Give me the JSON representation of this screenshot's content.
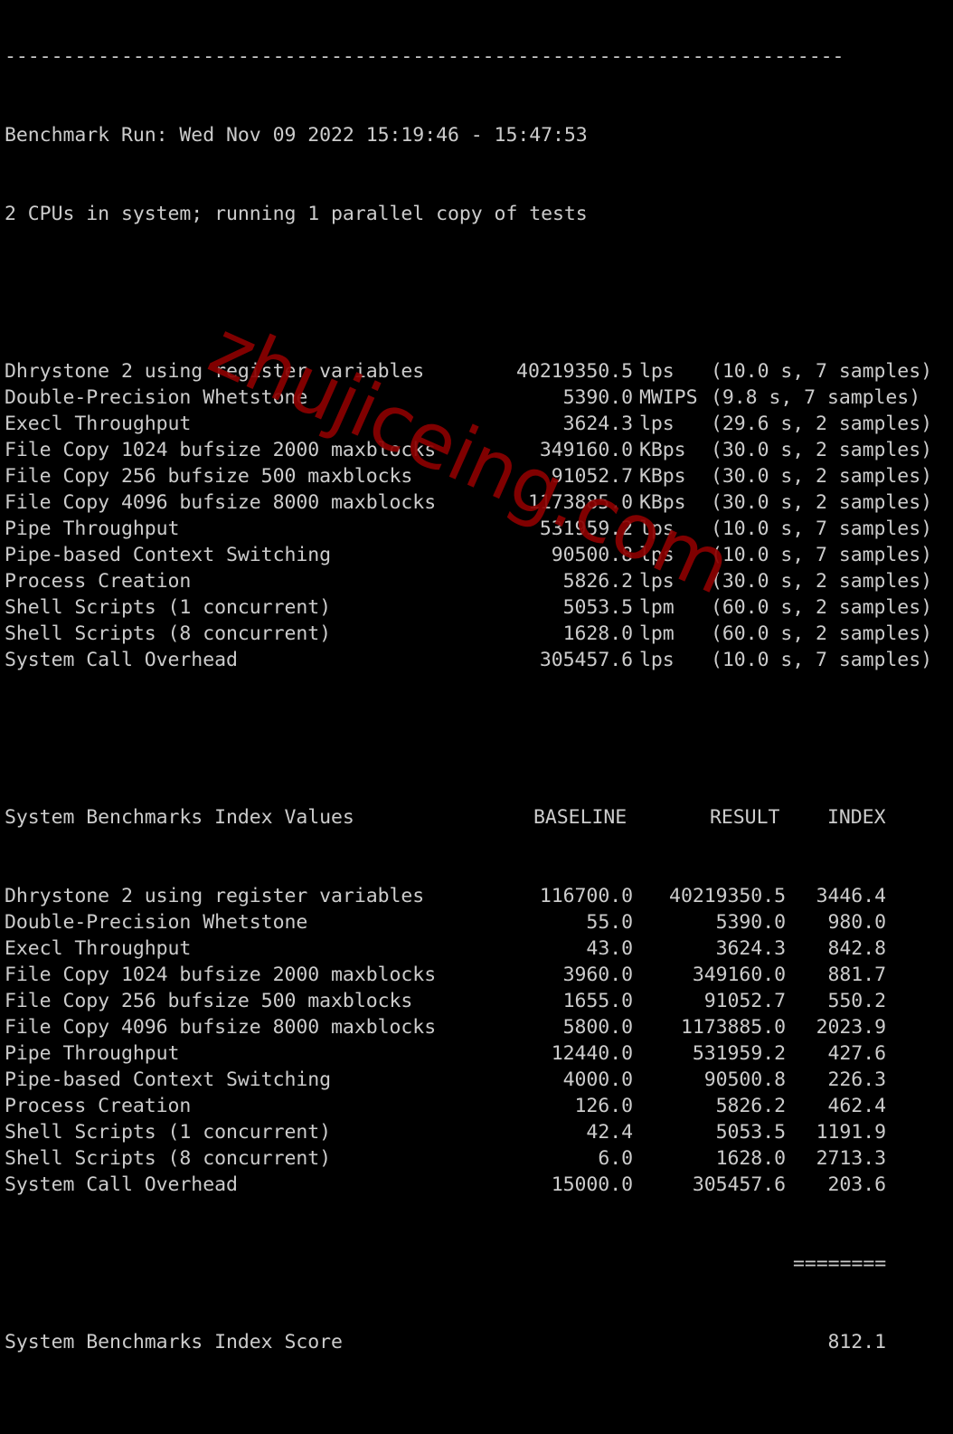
{
  "separator": "------------------------------------------------------------------------",
  "header": {
    "run_line": "Benchmark Run: Wed Nov 09 2022 15:19:46 - 15:47:53",
    "cpu_line": "2 CPUs in system; running 1 parallel copy of tests"
  },
  "results": [
    {
      "name": "Dhrystone 2 using register variables",
      "value": "40219350.5",
      "unit": "lps",
      "detail": "(10.0 s, 7 samples)"
    },
    {
      "name": "Double-Precision Whetstone",
      "value": "5390.0",
      "unit": "MWIPS",
      "detail": "(9.8 s, 7 samples)"
    },
    {
      "name": "Execl Throughput",
      "value": "3624.3",
      "unit": "lps",
      "detail": "(29.6 s, 2 samples)"
    },
    {
      "name": "File Copy 1024 bufsize 2000 maxblocks",
      "value": "349160.0",
      "unit": "KBps",
      "detail": "(30.0 s, 2 samples)"
    },
    {
      "name": "File Copy 256 bufsize 500 maxblocks",
      "value": "91052.7",
      "unit": "KBps",
      "detail": "(30.0 s, 2 samples)"
    },
    {
      "name": "File Copy 4096 bufsize 8000 maxblocks",
      "value": "1173885.0",
      "unit": "KBps",
      "detail": "(30.0 s, 2 samples)"
    },
    {
      "name": "Pipe Throughput",
      "value": "531959.2",
      "unit": "lps",
      "detail": "(10.0 s, 7 samples)"
    },
    {
      "name": "Pipe-based Context Switching",
      "value": "90500.8",
      "unit": "lps",
      "detail": "(10.0 s, 7 samples)"
    },
    {
      "name": "Process Creation",
      "value": "5826.2",
      "unit": "lps",
      "detail": "(30.0 s, 2 samples)"
    },
    {
      "name": "Shell Scripts (1 concurrent)",
      "value": "5053.5",
      "unit": "lpm",
      "detail": "(60.0 s, 2 samples)"
    },
    {
      "name": "Shell Scripts (8 concurrent)",
      "value": "1628.0",
      "unit": "lpm",
      "detail": "(60.0 s, 2 samples)"
    },
    {
      "name": "System Call Overhead",
      "value": "305457.6",
      "unit": "lps",
      "detail": "(10.0 s, 7 samples)"
    }
  ],
  "index_table": {
    "title": "System Benchmarks Index Values",
    "headers": {
      "baseline": "BASELINE",
      "result": "RESULT",
      "index": "INDEX"
    },
    "rows": [
      {
        "name": "Dhrystone 2 using register variables",
        "baseline": "116700.0",
        "result": "40219350.5",
        "index": "3446.4"
      },
      {
        "name": "Double-Precision Whetstone",
        "baseline": "55.0",
        "result": "5390.0",
        "index": "980.0"
      },
      {
        "name": "Execl Throughput",
        "baseline": "43.0",
        "result": "3624.3",
        "index": "842.8"
      },
      {
        "name": "File Copy 1024 bufsize 2000 maxblocks",
        "baseline": "3960.0",
        "result": "349160.0",
        "index": "881.7"
      },
      {
        "name": "File Copy 256 bufsize 500 maxblocks",
        "baseline": "1655.0",
        "result": "91052.7",
        "index": "550.2"
      },
      {
        "name": "File Copy 4096 bufsize 8000 maxblocks",
        "baseline": "5800.0",
        "result": "1173885.0",
        "index": "2023.9"
      },
      {
        "name": "Pipe Throughput",
        "baseline": "12440.0",
        "result": "531959.2",
        "index": "427.6"
      },
      {
        "name": "Pipe-based Context Switching",
        "baseline": "4000.0",
        "result": "90500.8",
        "index": "226.3"
      },
      {
        "name": "Process Creation",
        "baseline": "126.0",
        "result": "5826.2",
        "index": "462.4"
      },
      {
        "name": "Shell Scripts (1 concurrent)",
        "baseline": "42.4",
        "result": "5053.5",
        "index": "1191.9"
      },
      {
        "name": "Shell Scripts (8 concurrent)",
        "baseline": "6.0",
        "result": "1628.0",
        "index": "2713.3"
      },
      {
        "name": "System Call Overhead",
        "baseline": "15000.0",
        "result": "305457.6",
        "index": "203.6"
      }
    ],
    "rule": "========",
    "score_label": "System Benchmarks Index Score",
    "score": "812.1"
  },
  "watermark": "zhujiceing.com",
  "colors": {
    "background": "#000000",
    "text": "#cccccc",
    "watermark": "#8b0000"
  }
}
